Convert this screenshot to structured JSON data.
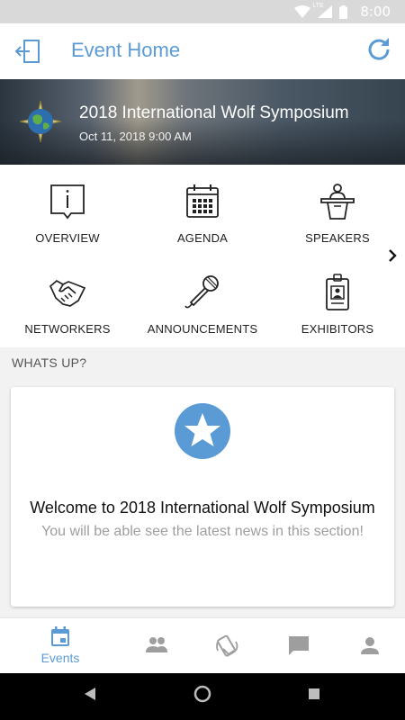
{
  "status_bar": {
    "time": "8:00",
    "network_label": "LTE",
    "icons": [
      "wifi-icon",
      "signal-icon",
      "battery-icon"
    ]
  },
  "app_bar": {
    "title": "Event Home",
    "back_icon": "exit-icon",
    "refresh_icon": "refresh-icon"
  },
  "event": {
    "title": "2018 International Wolf Symposium",
    "date": "Oct 11, 2018 9:00 AM",
    "logo_icon": "globe-logo-icon"
  },
  "menu": {
    "items": [
      {
        "label": "OVERVIEW",
        "icon": "info-icon"
      },
      {
        "label": "AGENDA",
        "icon": "calendar-icon"
      },
      {
        "label": "SPEAKERS",
        "icon": "podium-icon"
      },
      {
        "label": "NETWORKERS",
        "icon": "handshake-icon"
      },
      {
        "label": "ANNOUNCEMENTS",
        "icon": "microphone-icon"
      },
      {
        "label": "EXHIBITORS",
        "icon": "badge-icon"
      }
    ],
    "next_icon": "chevron-right-icon"
  },
  "whats_up": {
    "header": "WHATS UP?",
    "welcome": "Welcome to 2018 International Wolf Symposium",
    "subtitle": "You will be able see the latest news in this section!",
    "icon": "star-icon"
  },
  "bottom_nav": {
    "items": [
      {
        "label": "Events",
        "icon": "calendar-icon",
        "active": true
      },
      {
        "label": "",
        "icon": "people-icon",
        "active": false
      },
      {
        "label": "",
        "icon": "nfc-handshake-icon",
        "active": false
      },
      {
        "label": "",
        "icon": "chat-icon",
        "active": false
      },
      {
        "label": "",
        "icon": "person-icon",
        "active": false
      }
    ]
  },
  "colors": {
    "accent": "#5b9bd5",
    "inactive_icon": "#9e9e9e",
    "section_bg": "#f2f2f2"
  }
}
